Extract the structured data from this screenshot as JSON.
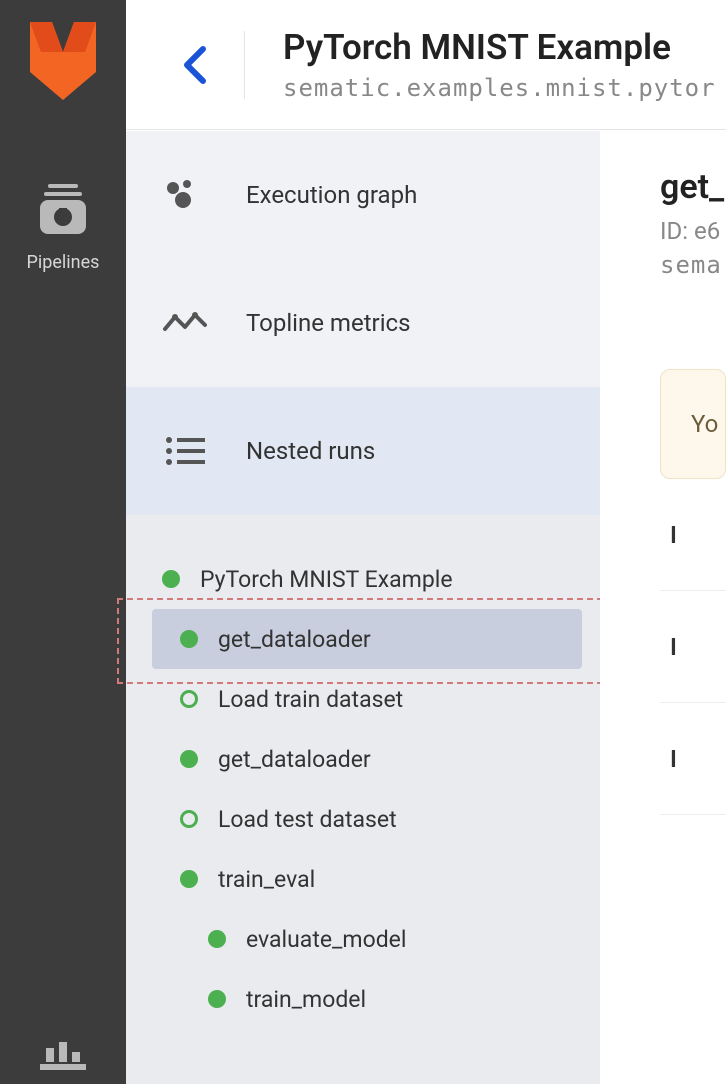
{
  "sidebar": {
    "items": [
      {
        "label": "Pipelines"
      }
    ]
  },
  "header": {
    "title": "PyTorch MNIST Example",
    "subtitle": "sematic.examples.mnist.pytor"
  },
  "nav": {
    "execution_graph": "Execution graph",
    "topline_metrics": "Topline metrics",
    "nested_runs": "Nested runs"
  },
  "tree": [
    {
      "label": "PyTorch MNIST Example",
      "depth": 0,
      "status": "solid",
      "selected": false
    },
    {
      "label": "get_dataloader",
      "depth": 1,
      "status": "solid",
      "selected": true
    },
    {
      "label": "Load train dataset",
      "depth": 1,
      "status": "hollow",
      "selected": false
    },
    {
      "label": "get_dataloader",
      "depth": 1,
      "status": "solid",
      "selected": false
    },
    {
      "label": "Load test dataset",
      "depth": 1,
      "status": "hollow",
      "selected": false
    },
    {
      "label": "train_eval",
      "depth": 1,
      "status": "solid",
      "selected": false
    },
    {
      "label": "evaluate_model",
      "depth": 2,
      "status": "solid",
      "selected": false
    },
    {
      "label": "train_model",
      "depth": 2,
      "status": "solid",
      "selected": false
    }
  ],
  "details": {
    "title": "get_",
    "id_line": "ID: e6",
    "path": "sema",
    "callout": "Yo",
    "rows": [
      "I",
      "I",
      "I"
    ]
  }
}
